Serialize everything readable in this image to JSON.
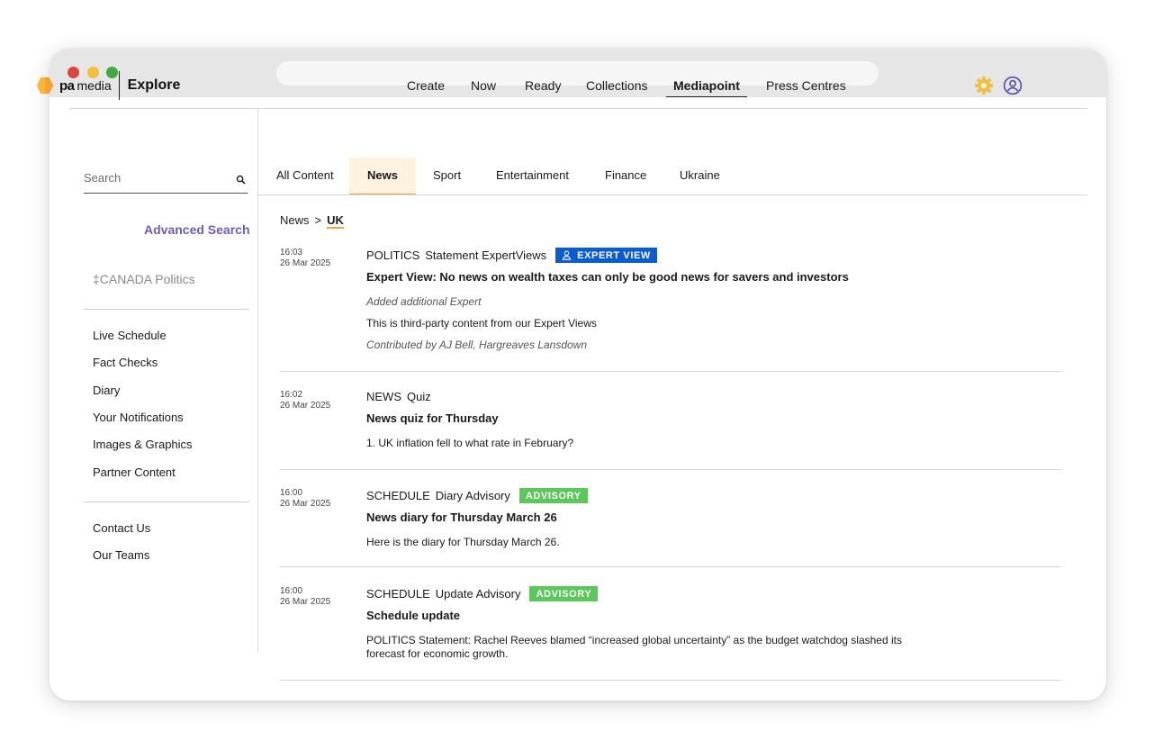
{
  "header": {
    "logo_pa": "pa",
    "logo_media": "media",
    "logo_product": "Explore",
    "nav": [
      "Create",
      "Now",
      "Ready",
      "Collections",
      "Mediapoint",
      "Press Centres"
    ],
    "active_nav": "Mediapoint"
  },
  "sidebar": {
    "search_placeholder": "Search",
    "advanced_search": "Advanced Search",
    "saved_search": "‡CANADA Politics",
    "links": [
      "Live Schedule",
      "Fact Checks",
      "Diary",
      "Your Notifications",
      "Images & Graphics",
      "Partner Content"
    ],
    "footer_links": [
      "Contact Us",
      "Our Teams"
    ]
  },
  "tabs": [
    "All Content",
    "News",
    "Sport",
    "Entertainment",
    "Finance",
    "Ukraine"
  ],
  "active_tab": "News",
  "breadcrumb": {
    "parent": "News",
    "separator": ">",
    "current": "UK"
  },
  "articles": [
    {
      "time": "16:03",
      "date": "26 Mar 2025",
      "category": "POLITICS",
      "type": "Statement ExpertViews",
      "badge": "EXPERT VIEW",
      "headline": "Expert View: No news on wealth taxes can only be good news for savers and investors",
      "note": "Added additional Expert",
      "summary": "This is third-party content from our Expert Views",
      "contributed": "Contributed by AJ Bell, Hargreaves Lansdown"
    },
    {
      "time": "16:02",
      "date": "26 Mar 2025",
      "category": "NEWS",
      "type": "Quiz",
      "headline": "News quiz for Thursday",
      "summary": "1. UK inflation fell to what rate in February?"
    },
    {
      "time": "16:00",
      "date": "26 Mar 2025",
      "category": "SCHEDULE",
      "type": "Diary Advisory",
      "badge": "ADVISORY",
      "headline": "News diary for Thursday March 26",
      "summary": "Here is the diary for Thursday March 26."
    },
    {
      "time": "16:00",
      "date": "26 Mar 2025",
      "category": "SCHEDULE",
      "type": "Update Advisory",
      "badge": "ADVISORY",
      "headline": "Schedule update",
      "summary_line1": "POLITICS Statement: Rachel Reeves blamed “increased global uncertainty” as the budget watchdog slashed its",
      "summary_line2": "forecast for economic growth."
    }
  ],
  "colors": {
    "accent_orange": "#f2a541",
    "advanced_search": "#6a5fb8",
    "expert_badge": "#0b5bd7",
    "advisory_badge": "#5cc85c",
    "settings_icon": "#f3be3a",
    "account_icon": "#5a4fb0"
  },
  "icons": {
    "logo": "hexagon-logo-icon",
    "settings": "gear-icon",
    "account": "user-circle-icon",
    "search": "search-icon",
    "expert": "person-icon"
  }
}
